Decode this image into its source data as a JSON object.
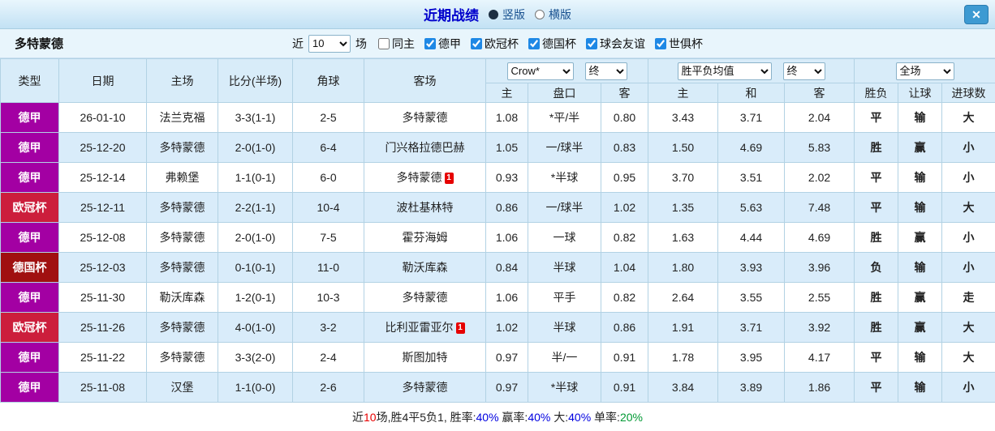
{
  "palette": {
    "red": "#e80000",
    "blue": "#0000e0",
    "green": "#009933",
    "black": "#222222",
    "league": {
      "德甲": "#a300a3",
      "欧冠杯": "#cc1e3c",
      "德国杯": "#a01010"
    }
  },
  "titlebar": {
    "title": "近期战绩",
    "vertical_label": "竖版",
    "horizontal_label": "横版",
    "selected_layout": "竖版",
    "close_glyph": "✕"
  },
  "filter": {
    "team": "多特蒙德",
    "near_label": "近",
    "count": "10",
    "count_suffix": "场",
    "checkboxes": [
      {
        "label": "同主",
        "checked": false
      },
      {
        "label": "德甲",
        "checked": true
      },
      {
        "label": "欧冠杯",
        "checked": true
      },
      {
        "label": "德国杯",
        "checked": true
      },
      {
        "label": "球会友谊",
        "checked": true
      },
      {
        "label": "世俱杯",
        "checked": true
      }
    ]
  },
  "table": {
    "static_headers": [
      "类型",
      "日期",
      "主场",
      "比分(半场)",
      "角球",
      "客场"
    ],
    "odds_group": {
      "bookmaker": "Crow*",
      "time": "终",
      "sub": [
        "主",
        "盘口",
        "客"
      ]
    },
    "europe_group": {
      "source": "胜平负均值",
      "time": "终",
      "sub": [
        "主",
        "和",
        "客"
      ]
    },
    "result_group": {
      "scope": "全场",
      "sub": [
        "胜负",
        "让球",
        "进球数"
      ]
    },
    "rows": [
      {
        "league": "德甲",
        "date": "26-01-10",
        "home": "法兰克福",
        "home_dortmund": false,
        "score": "3-3(1-1)",
        "corner": "2-5",
        "away": "多特蒙德",
        "away_dortmund": true,
        "away_card": null,
        "asia_home": "1.08",
        "handicap": "*平/半",
        "handicap_red": true,
        "asia_away": "0.80",
        "eu_home": "3.43",
        "eu_draw": "3.71",
        "eu_away": "2.04",
        "result": {
          "t": "平",
          "c": "blue"
        },
        "handicap_result": {
          "t": "输",
          "c": "blue"
        },
        "goals": {
          "t": "大",
          "c": "red"
        }
      },
      {
        "league": "德甲",
        "date": "25-12-20",
        "home": "多特蒙德",
        "home_dortmund": true,
        "score": "2-0(1-0)",
        "corner": "6-4",
        "away": "门兴格拉德巴赫",
        "away_dortmund": false,
        "away_card": null,
        "asia_home": "1.05",
        "handicap": "一/球半",
        "handicap_red": false,
        "asia_away": "0.83",
        "eu_home": "1.50",
        "eu_draw": "4.69",
        "eu_away": "5.83",
        "result": {
          "t": "胜",
          "c": "red"
        },
        "handicap_result": {
          "t": "赢",
          "c": "red"
        },
        "goals": {
          "t": "小",
          "c": "green"
        }
      },
      {
        "league": "德甲",
        "date": "25-12-14",
        "home": "弗赖堡",
        "home_dortmund": false,
        "score": "1-1(0-1)",
        "corner": "6-0",
        "away": "多特蒙德",
        "away_dortmund": true,
        "away_card": "1",
        "asia_home": "0.93",
        "handicap": "*半球",
        "handicap_red": true,
        "asia_away": "0.95",
        "eu_home": "3.70",
        "eu_draw": "3.51",
        "eu_away": "2.02",
        "result": {
          "t": "平",
          "c": "blue"
        },
        "handicap_result": {
          "t": "输",
          "c": "blue"
        },
        "goals": {
          "t": "小",
          "c": "green"
        }
      },
      {
        "league": "欧冠杯",
        "date": "25-12-11",
        "home": "多特蒙德",
        "home_dortmund": true,
        "score": "2-2(1-1)",
        "corner": "10-4",
        "away": "波杜基林特",
        "away_dortmund": false,
        "away_card": null,
        "asia_home": "0.86",
        "handicap": "一/球半",
        "handicap_red": false,
        "asia_away": "1.02",
        "eu_home": "1.35",
        "eu_draw": "5.63",
        "eu_away": "7.48",
        "result": {
          "t": "平",
          "c": "blue"
        },
        "handicap_result": {
          "t": "输",
          "c": "blue"
        },
        "goals": {
          "t": "大",
          "c": "red"
        }
      },
      {
        "league": "德甲",
        "date": "25-12-08",
        "home": "多特蒙德",
        "home_dortmund": true,
        "score": "2-0(1-0)",
        "corner": "7-5",
        "away": "霍芬海姆",
        "away_dortmund": false,
        "away_card": null,
        "asia_home": "1.06",
        "handicap": "一球",
        "handicap_red": false,
        "asia_away": "0.82",
        "eu_home": "1.63",
        "eu_draw": "4.44",
        "eu_away": "4.69",
        "result": {
          "t": "胜",
          "c": "red"
        },
        "handicap_result": {
          "t": "赢",
          "c": "red"
        },
        "goals": {
          "t": "小",
          "c": "green"
        }
      },
      {
        "league": "德国杯",
        "date": "25-12-03",
        "home": "多特蒙德",
        "home_dortmund": true,
        "score": "0-1(0-1)",
        "corner": "11-0",
        "away": "勒沃库森",
        "away_dortmund": false,
        "away_card": null,
        "asia_home": "0.84",
        "handicap": "半球",
        "handicap_red": false,
        "asia_away": "1.04",
        "eu_home": "1.80",
        "eu_draw": "3.93",
        "eu_away": "3.96",
        "result": {
          "t": "负",
          "c": "blue"
        },
        "handicap_result": {
          "t": "输",
          "c": "blue"
        },
        "goals": {
          "t": "小",
          "c": "green"
        }
      },
      {
        "league": "德甲",
        "date": "25-11-30",
        "home": "勒沃库森",
        "home_dortmund": false,
        "score": "1-2(0-1)",
        "corner": "10-3",
        "away": "多特蒙德",
        "away_dortmund": true,
        "away_card": null,
        "asia_home": "1.06",
        "handicap": "平手",
        "handicap_red": false,
        "asia_away": "0.82",
        "eu_home": "2.64",
        "eu_draw": "3.55",
        "eu_away": "2.55",
        "result": {
          "t": "胜",
          "c": "red"
        },
        "handicap_result": {
          "t": "赢",
          "c": "red"
        },
        "goals": {
          "t": "走",
          "c": "blue"
        }
      },
      {
        "league": "欧冠杯",
        "date": "25-11-26",
        "home": "多特蒙德",
        "home_dortmund": true,
        "score": "4-0(1-0)",
        "corner": "3-2",
        "away": "比利亚雷亚尔",
        "away_dortmund": false,
        "away_card": "1",
        "asia_home": "1.02",
        "handicap": "半球",
        "handicap_red": false,
        "asia_away": "0.86",
        "eu_home": "1.91",
        "eu_draw": "3.71",
        "eu_away": "3.92",
        "result": {
          "t": "胜",
          "c": "red"
        },
        "handicap_result": {
          "t": "赢",
          "c": "red"
        },
        "goals": {
          "t": "大",
          "c": "red"
        }
      },
      {
        "league": "德甲",
        "date": "25-11-22",
        "home": "多特蒙德",
        "home_dortmund": true,
        "score": "3-3(2-0)",
        "corner": "2-4",
        "away": "斯图加特",
        "away_dortmund": false,
        "away_card": null,
        "asia_home": "0.97",
        "handicap": "半/一",
        "handicap_red": false,
        "asia_away": "0.91",
        "eu_home": "1.78",
        "eu_draw": "3.95",
        "eu_away": "4.17",
        "result": {
          "t": "平",
          "c": "blue"
        },
        "handicap_result": {
          "t": "输",
          "c": "blue"
        },
        "goals": {
          "t": "大",
          "c": "red"
        }
      },
      {
        "league": "德甲",
        "date": "25-11-08",
        "home": "汉堡",
        "home_dortmund": false,
        "score": "1-1(0-0)",
        "corner": "2-6",
        "away": "多特蒙德",
        "away_dortmund": true,
        "away_card": null,
        "asia_home": "0.97",
        "handicap": "*半球",
        "handicap_red": true,
        "asia_away": "0.91",
        "eu_home": "3.84",
        "eu_draw": "3.89",
        "eu_away": "1.86",
        "result": {
          "t": "平",
          "c": "blue"
        },
        "handicap_result": {
          "t": "输",
          "c": "blue"
        },
        "goals": {
          "t": "小",
          "c": "green"
        }
      }
    ]
  },
  "summary": {
    "segments": [
      {
        "t": "近",
        "c": "black"
      },
      {
        "t": "10",
        "c": "red"
      },
      {
        "t": "场,胜4平5负1, 胜率:",
        "c": "black"
      },
      {
        "t": "40%",
        "c": "blue"
      },
      {
        "t": " 赢率:",
        "c": "black"
      },
      {
        "t": "40%",
        "c": "blue"
      },
      {
        "t": " 大:",
        "c": "black"
      },
      {
        "t": "40%",
        "c": "blue"
      },
      {
        "t": " 单率:",
        "c": "black"
      },
      {
        "t": "20%",
        "c": "green"
      }
    ]
  }
}
